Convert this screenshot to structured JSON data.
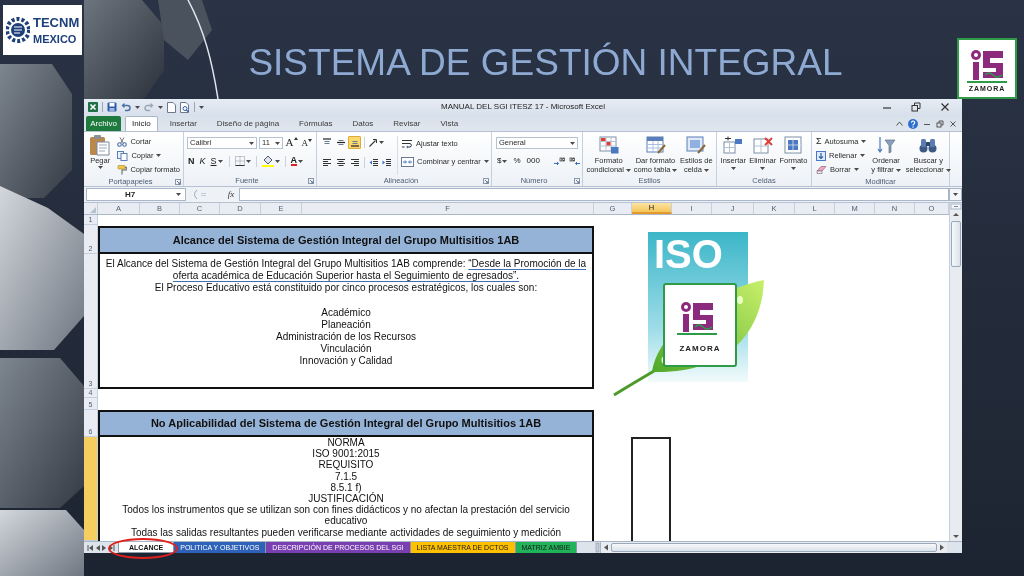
{
  "slide": {
    "title": "SISTEMA DE GESTIÓN INTEGRAL",
    "left_logo": {
      "name": "TECNM",
      "country": "MEXICO"
    },
    "right_logo": {
      "label": "ZAMORA"
    }
  },
  "window": {
    "title": "MANUAL DEL SGI ITESZ 17 - Microsoft Excel"
  },
  "file_tab": {
    "label": "Archivo"
  },
  "tabs": [
    {
      "label": "Inicio",
      "selected": true
    },
    {
      "label": "Insertar",
      "selected": false
    },
    {
      "label": "Diseño de página",
      "selected": false
    },
    {
      "label": "Fórmulas",
      "selected": false
    },
    {
      "label": "Datos",
      "selected": false
    },
    {
      "label": "Revisar",
      "selected": false
    },
    {
      "label": "Vista",
      "selected": false
    }
  ],
  "ribbon": [
    {
      "kind": "clipboard",
      "label": "Portapapeles",
      "launcher": true,
      "paste": {
        "label": "Pegar",
        "dropdown": true
      },
      "items": [
        {
          "kind": "cut",
          "label": "Cortar",
          "dropdown": false
        },
        {
          "kind": "copy",
          "label": "Copiar",
          "dropdown": true
        },
        {
          "kind": "painter",
          "label": "Copiar formato",
          "dropdown": false
        }
      ]
    },
    {
      "kind": "font",
      "label": "Fuente",
      "launcher": true,
      "family": "Calibri",
      "size": "11",
      "resize": [
        {
          "kind": "grow",
          "glyph": "A"
        },
        {
          "kind": "shrink",
          "glyph": "A"
        }
      ],
      "styles": [
        {
          "kind": "bold",
          "glyph": "N",
          "dropdown": false
        },
        {
          "kind": "italic",
          "glyph": "K",
          "dropdown": false
        },
        {
          "kind": "underline",
          "glyph": "S",
          "dropdown": true
        }
      ],
      "tools": [
        {
          "kind": "borders",
          "dropdown": true
        },
        {
          "kind": "fill",
          "dropdown": true
        },
        {
          "kind": "font_color",
          "glyph": "A",
          "dropdown": true
        }
      ]
    },
    {
      "kind": "alignment",
      "label": "Alineación",
      "launcher": true,
      "vertical": [
        {
          "kind": "top",
          "selected": false
        },
        {
          "kind": "middle",
          "selected": false
        },
        {
          "kind": "bottom",
          "selected": true
        }
      ],
      "orientation": {
        "dropdown": true
      },
      "horizontal": [
        {
          "kind": "left",
          "selected": false
        },
        {
          "kind": "center",
          "selected": false
        },
        {
          "kind": "right",
          "selected": false
        }
      ],
      "indent": [
        {
          "kind": "decrease"
        },
        {
          "kind": "increase"
        }
      ],
      "wrap": {
        "label": "Ajustar texto"
      },
      "merge": {
        "label": "Combinar y centrar",
        "dropdown": true
      }
    },
    {
      "kind": "number",
      "label": "Número",
      "launcher": true,
      "format": "General",
      "symbols": [
        {
          "glyph": "$",
          "dropdown": true
        },
        {
          "glyph": "%",
          "dropdown": false
        },
        {
          "glyph": "000",
          "dropdown": false
        }
      ],
      "decimals": [
        {
          "kind": "increase"
        },
        {
          "kind": "decrease"
        }
      ]
    },
    {
      "kind": "large",
      "label": "Estilos",
      "launcher": false,
      "buttons": [
        {
          "kind": "conditional",
          "label": "Formato\ncondicional",
          "dropdown": true
        },
        {
          "kind": "table",
          "label": "Dar formato\ncomo tabla",
          "dropdown": true
        },
        {
          "kind": "cell_styles",
          "label": "Estilos de\ncelda",
          "dropdown": true
        }
      ]
    },
    {
      "kind": "large",
      "label": "Celdas",
      "launcher": false,
      "buttons": [
        {
          "kind": "insert",
          "label": "Insertar",
          "dropdown": true
        },
        {
          "kind": "delete",
          "label": "Eliminar",
          "dropdown": true
        },
        {
          "kind": "format",
          "label": "Formato",
          "dropdown": true
        }
      ]
    },
    {
      "kind": "editing",
      "label": "Modificar",
      "launcher": false,
      "items": [
        {
          "kind": "autosum",
          "glyph": "Σ",
          "label": "Autosuma",
          "dropdown": true
        },
        {
          "kind": "fill",
          "label": "Rellenar",
          "dropdown": true
        },
        {
          "kind": "clear",
          "label": "Borrar",
          "dropdown": true
        }
      ],
      "buttons": [
        {
          "kind": "sort",
          "label": "Ordenar\ny filtrar",
          "dropdown": true
        },
        {
          "kind": "find",
          "label": "Buscar y\nseleccionar",
          "dropdown": true
        }
      ]
    }
  ],
  "formula_bar": {
    "name_box": "H7",
    "function_button": "fx"
  },
  "columns": [
    {
      "label": "A",
      "selected": false
    },
    {
      "label": "B",
      "selected": false
    },
    {
      "label": "C",
      "selected": false
    },
    {
      "label": "D",
      "selected": false
    },
    {
      "label": "E",
      "selected": false
    },
    {
      "label": "F",
      "selected": false
    },
    {
      "label": "G",
      "selected": false
    },
    {
      "label": "H",
      "selected": true
    },
    {
      "label": "I",
      "selected": false
    },
    {
      "label": "J",
      "selected": false
    },
    {
      "label": "K",
      "selected": false
    },
    {
      "label": "L",
      "selected": false
    },
    {
      "label": "M",
      "selected": false
    },
    {
      "label": "N",
      "selected": false
    },
    {
      "label": "O",
      "selected": false
    }
  ],
  "rows": [
    {
      "label": "1",
      "selected": false
    },
    {
      "label": "2",
      "selected": false
    },
    {
      "label": "3",
      "selected": false
    },
    {
      "label": "4",
      "selected": false
    },
    {
      "label": "5",
      "selected": false
    },
    {
      "label": "6",
      "selected": false
    },
    {
      "selected": true
    }
  ],
  "sheet": {
    "scope_block": {
      "heading": "Alcance del Sistema de Gestión Integral del Grupo Multisitios 1AB",
      "intro": {
        "text": "El Alcance del Sistema de Gestión Integral del Grupo Multisitios 1AB comprende: ",
        "quote": "“Desde la Promoción de la oferta académica de Educación Superior hasta el Seguimiento de egresados”."
      },
      "note": "El Proceso Educativo está constituido por cinco procesos estratégicos, los cuales son:",
      "processes": [
        "Académico",
        "Planeación",
        "Administración de los Recursos",
        "Vinculación",
        "Innovación y Calidad"
      ]
    },
    "non_applicability_block": {
      "heading": "No Aplicabilidad del Sistema de Gestión Integral del Grupo Multisitios 1AB",
      "lines": [
        "NORMA",
        "ISO 9001:2015",
        "REQUISITO",
        "7.1.5",
        "8.5.1 f)",
        "JUSTIFICACIÓN",
        "Todos los instrumentos que se utilizan son con fines didácticos y no afectan la prestación del servicio educativo",
        "Todas las salidas resultantes pueden verificarse mediante actividades de seguimiento y medición"
      ]
    },
    "picture": {
      "letters": "ISO",
      "emblem_label": "ZAMORA"
    }
  },
  "sheet_tabs": [
    {
      "label": "ALCANCE",
      "selected": true
    },
    {
      "label": "POLITICA Y OBJETIVOS",
      "selected": false,
      "color": "#2e62b8"
    },
    {
      "label": "DESCRIPCIÓN DE PROCESOS DEL SGI",
      "selected": false,
      "color": "#7a3fb0"
    },
    {
      "label": "LISTA MAESTRA DE DCTOS",
      "selected": false,
      "color": "#ffc000"
    },
    {
      "label": "MATRIZ AMBIE",
      "selected": false,
      "color": "#21b35a"
    }
  ]
}
